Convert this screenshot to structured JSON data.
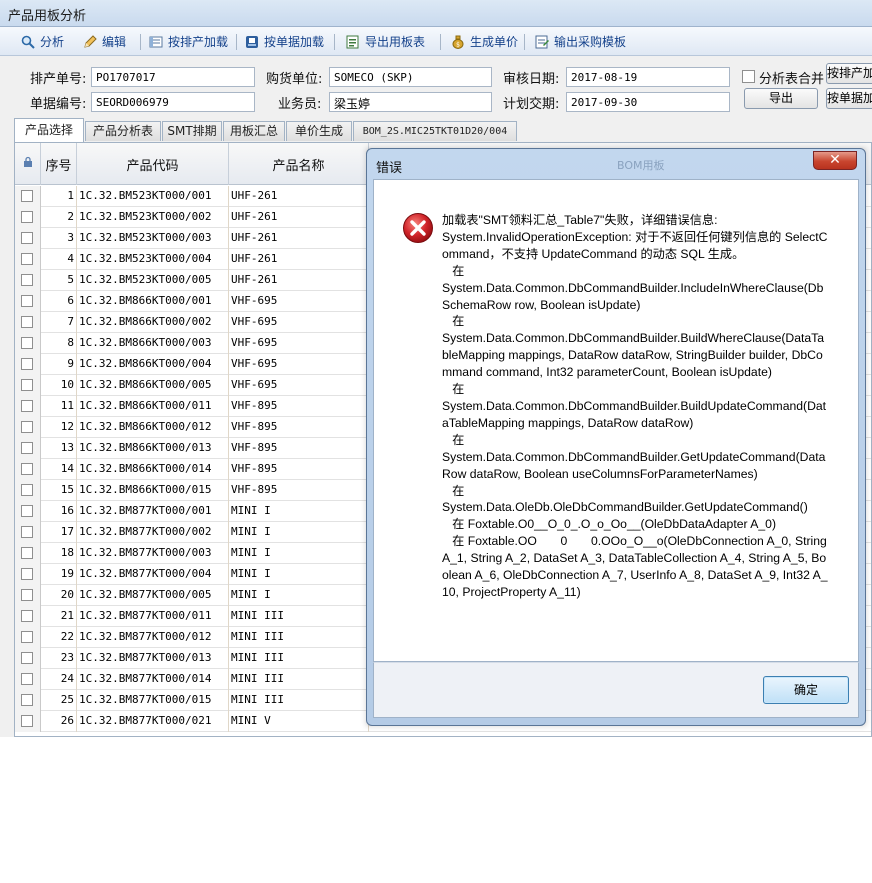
{
  "window": {
    "title": "产品用板分析"
  },
  "toolbar": {
    "items": [
      {
        "label": "分析",
        "icon": "magnifier-icon"
      },
      {
        "label": "编辑",
        "icon": "pencil-icon"
      },
      {
        "label": "按排产加载",
        "icon": "load-schedule-icon"
      },
      {
        "label": "按单据加载",
        "icon": "load-document-icon"
      },
      {
        "label": "导出用板表",
        "icon": "export-sheet-icon"
      },
      {
        "label": "生成单价",
        "icon": "money-bag-icon"
      },
      {
        "label": "输出采购模板",
        "icon": "purchase-template-icon"
      }
    ]
  },
  "form": {
    "schedule_no_label": "排产单号:",
    "schedule_no": "PO1707017",
    "document_no_label": "单据编号:",
    "document_no": "SEORD006979",
    "buyer_label": "购货单位:",
    "buyer": "SOMECO (SKP)",
    "salesman_label": "业务员:",
    "salesman": "梁玉婷",
    "audit_date_label": "审核日期:",
    "audit_date": "2017-08-19",
    "plan_date_label": "计划交期:",
    "plan_date": "2017-09-30",
    "merge_label": "分析表合并",
    "export_button": "导出",
    "load_schedule_button": "按排产加",
    "load_document_button": "按单据加"
  },
  "tabs": [
    "产品选择",
    "产品分析表",
    "SMT排期",
    "用板汇总",
    "单价生成",
    "BOM_2S.MIC25TKT01D20/004"
  ],
  "grid": {
    "headers": {
      "seq": "序号",
      "code": "产品代码",
      "name": "产品名称"
    },
    "rows": [
      {
        "seq": "1",
        "code": "1C.32.BM523KT000/001",
        "name": "UHF-261"
      },
      {
        "seq": "2",
        "code": "1C.32.BM523KT000/002",
        "name": "UHF-261"
      },
      {
        "seq": "3",
        "code": "1C.32.BM523KT000/003",
        "name": "UHF-261"
      },
      {
        "seq": "4",
        "code": "1C.32.BM523KT000/004",
        "name": "UHF-261"
      },
      {
        "seq": "5",
        "code": "1C.32.BM523KT000/005",
        "name": "UHF-261"
      },
      {
        "seq": "6",
        "code": "1C.32.BM866KT000/001",
        "name": "VHF-695"
      },
      {
        "seq": "7",
        "code": "1C.32.BM866KT000/002",
        "name": "VHF-695"
      },
      {
        "seq": "8",
        "code": "1C.32.BM866KT000/003",
        "name": "VHF-695"
      },
      {
        "seq": "9",
        "code": "1C.32.BM866KT000/004",
        "name": "VHF-695"
      },
      {
        "seq": "10",
        "code": "1C.32.BM866KT000/005",
        "name": "VHF-695"
      },
      {
        "seq": "11",
        "code": "1C.32.BM866KT000/011",
        "name": "VHF-895"
      },
      {
        "seq": "12",
        "code": "1C.32.BM866KT000/012",
        "name": "VHF-895"
      },
      {
        "seq": "13",
        "code": "1C.32.BM866KT000/013",
        "name": "VHF-895"
      },
      {
        "seq": "14",
        "code": "1C.32.BM866KT000/014",
        "name": "VHF-895"
      },
      {
        "seq": "15",
        "code": "1C.32.BM866KT000/015",
        "name": "VHF-895"
      },
      {
        "seq": "16",
        "code": "1C.32.BM877KT000/001",
        "name": "MINI I"
      },
      {
        "seq": "17",
        "code": "1C.32.BM877KT000/002",
        "name": "MINI I"
      },
      {
        "seq": "18",
        "code": "1C.32.BM877KT000/003",
        "name": "MINI I"
      },
      {
        "seq": "19",
        "code": "1C.32.BM877KT000/004",
        "name": "MINI I"
      },
      {
        "seq": "20",
        "code": "1C.32.BM877KT000/005",
        "name": "MINI I"
      },
      {
        "seq": "21",
        "code": "1C.32.BM877KT000/011",
        "name": "MINI III"
      },
      {
        "seq": "22",
        "code": "1C.32.BM877KT000/012",
        "name": "MINI III"
      },
      {
        "seq": "23",
        "code": "1C.32.BM877KT000/013",
        "name": "MINI III"
      },
      {
        "seq": "24",
        "code": "1C.32.BM877KT000/014",
        "name": "MINI III"
      },
      {
        "seq": "25",
        "code": "1C.32.BM877KT000/015",
        "name": "MINI III"
      },
      {
        "seq": "26",
        "code": "1C.32.BM877KT000/021",
        "name": "MINI V"
      }
    ]
  },
  "dialog": {
    "title": "错误",
    "background_title": "BOM用板",
    "close_label": "✕",
    "icon": "error-icon",
    "message": "加载表\"SMT领料汇总_Table7\"失败，详细错误信息:\nSystem.InvalidOperationException: 对于不返回任何键列信息的 SelectCommand，不支持 UpdateCommand 的动态 SQL 生成。\n   在\nSystem.Data.Common.DbCommandBuilder.IncludeInWhereClause(DbSchemaRow row, Boolean isUpdate)\n   在\nSystem.Data.Common.DbCommandBuilder.BuildWhereClause(DataTableMapping mappings, DataRow dataRow, StringBuilder builder, DbCommand command, Int32 parameterCount, Boolean isUpdate)\n   在\nSystem.Data.Common.DbCommandBuilder.BuildUpdateCommand(DataTableMapping mappings, DataRow dataRow)\n   在\nSystem.Data.Common.DbCommandBuilder.GetUpdateCommand(DataRow dataRow, Boolean useColumnsForParameterNames)\n   在\nSystem.Data.OleDb.OleDbCommandBuilder.GetUpdateCommand()\n   在 Foxtable.O0__O_0_.O_o_Oo__(OleDbDataAdapter A_0)\n   在 Foxtable.OO       0       0.OOo_O__o(OleDbConnection A_0, String A_1, String A_2, DataSet A_3, DataTableCollection A_4, String A_5, Boolean A_6, OleDbConnection A_7, UserInfo A_8, DataSet A_9, Int32 A_10, ProjectProperty A_11)",
    "ok_button": "确定"
  },
  "colors": {
    "accent": "#15428b",
    "error_red": "#d1242a",
    "grid_line": "#e0d7c8"
  }
}
